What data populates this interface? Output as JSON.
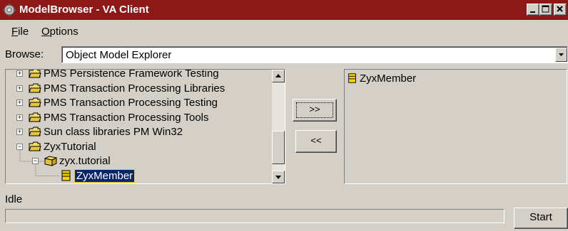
{
  "window": {
    "title": "ModelBrowser - VA Client",
    "title_bar_color": "#8e1818",
    "app_icon": "gear-icon",
    "controls": [
      "minimize-icon",
      "maximize-icon",
      "close-icon"
    ]
  },
  "menu": {
    "file": {
      "first": "F",
      "rest": "ile"
    },
    "options": {
      "first": "O",
      "rest": "ptions"
    }
  },
  "browse": {
    "label": "Browse:",
    "value": "Object Model Explorer"
  },
  "tree": {
    "items": [
      {
        "label": "PMS Persistence Framework Testing",
        "expander": "+",
        "icon": "folder-icon"
      },
      {
        "label": "PMS Transaction Processing Libraries",
        "expander": "+",
        "icon": "folder-icon"
      },
      {
        "label": "PMS Transaction Processing Testing",
        "expander": "+",
        "icon": "folder-icon"
      },
      {
        "label": "PMS Transaction Processing Tools",
        "expander": "+",
        "icon": "folder-icon"
      },
      {
        "label": "Sun class libraries PM Win32",
        "expander": "+",
        "icon": "folder-icon"
      },
      {
        "label": "ZyxTutorial",
        "expander": "−",
        "icon": "folder-open-icon"
      },
      {
        "label": "zyx.tutorial",
        "expander": "−",
        "icon": "package-icon"
      },
      {
        "label": "ZyxMember",
        "expander": "",
        "icon": "class-icon",
        "selected": true
      }
    ],
    "selection_color": "#0a246a"
  },
  "buttons": {
    "add": ">>",
    "remove": "<<",
    "start": "Start"
  },
  "right_list": {
    "items": [
      {
        "label": "ZyxMember",
        "icon": "class-icon"
      }
    ]
  },
  "status": {
    "text": "Idle",
    "progress": 0
  }
}
